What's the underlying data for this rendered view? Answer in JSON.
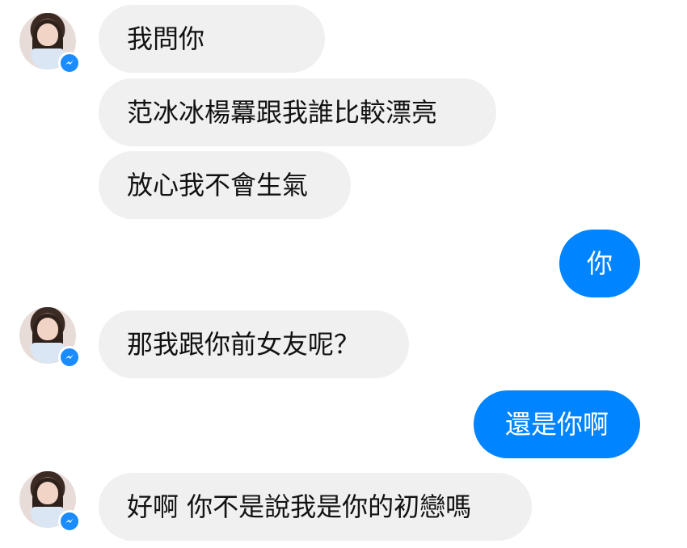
{
  "conversation": {
    "incoming": [
      {
        "text": "我問你",
        "sender": "contact"
      },
      {
        "text": "范冰冰楊羃跟我誰比較漂亮",
        "sender": "contact"
      },
      {
        "text": "放心我不會生氣",
        "sender": "contact"
      },
      {
        "text": "那我跟你前女友呢？",
        "sender": "contact"
      },
      {
        "text": "好啊 你不是說我是你的初戀嗎",
        "sender": "contact"
      }
    ],
    "outgoing": [
      {
        "text": "你",
        "sender": "me"
      },
      {
        "text": "還是你啊",
        "sender": "me"
      }
    ]
  },
  "contact": {
    "avatar_icon": "profile-photo",
    "badge_icon": "messenger-icon"
  },
  "colors": {
    "incoming_bubble": "#f0f0f0",
    "outgoing_bubble": "#0084ff",
    "badge": "#1a8cff"
  }
}
